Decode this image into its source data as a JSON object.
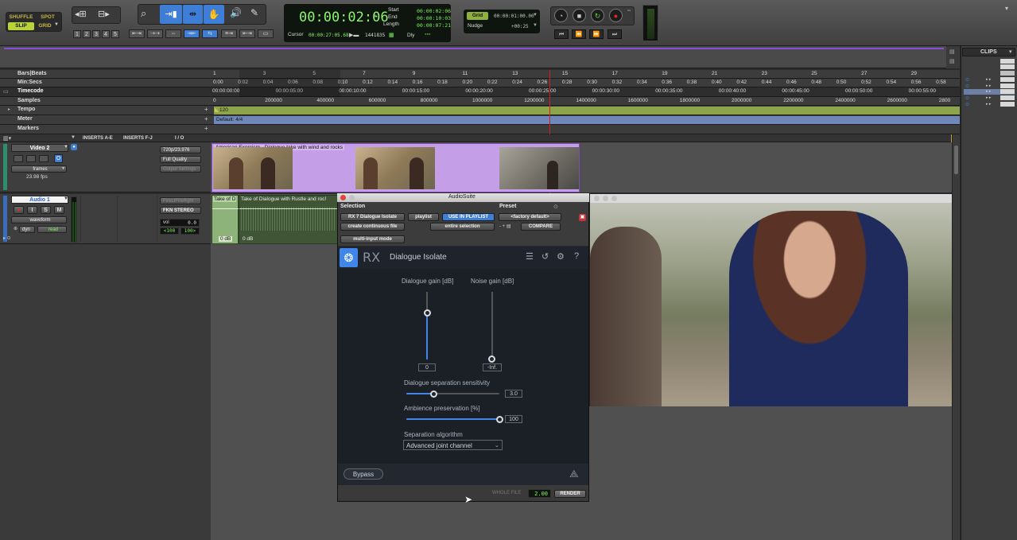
{
  "edit_modes": {
    "shuffle": "SHUFFLE",
    "spot": "SPOT",
    "slip": "SLIP",
    "grid": "GRID"
  },
  "zoom_presets": [
    "1",
    "2",
    "3",
    "4",
    "5"
  ],
  "counter": {
    "main": "00:00:02:06",
    "start_label": "Start",
    "end_label": "End",
    "length_label": "Length",
    "start": "00:00:02:06",
    "end": "00:00:10:03",
    "length": "00:00:07:21",
    "cursor_label": "Cursor",
    "cursor": "00:00:27:05.68",
    "samples": "1441835",
    "dly_label": "Dly"
  },
  "grid": {
    "label": "Grid",
    "value": "00:00:01:00.00",
    "nudge_label": "Nudge",
    "nudge_value": "+00:25"
  },
  "clips_panel": {
    "title": "CLIPS"
  },
  "rulers": {
    "bars_beats": {
      "label": "Bars|Beats",
      "ticks": [
        "1",
        "3",
        "5",
        "7",
        "9",
        "11",
        "13",
        "15",
        "17",
        "19",
        "21",
        "23",
        "25",
        "27",
        "29"
      ]
    },
    "min_secs": {
      "label": "Min:Secs",
      "ticks": [
        "0:00",
        "0:02",
        "0:04",
        "0:06",
        "0:08",
        "0:10",
        "0:12",
        "0:14",
        "0:16",
        "0:18",
        "0:20",
        "0:22",
        "0:24",
        "0:26",
        "0:28",
        "0:30",
        "0:32",
        "0:34",
        "0:36",
        "0:38",
        "0:40",
        "0:42",
        "0:44",
        "0:46",
        "0:48",
        "0:50",
        "0:52",
        "0:54",
        "0:56",
        "0:58"
      ]
    },
    "timecode": {
      "label": "Timecode",
      "ticks": [
        "00:00:00:00",
        "00:00:05:00",
        "00:00:10:00",
        "00:00:15:00",
        "00:00:20:00",
        "00:00:25:00",
        "00:00:30:00",
        "00:00:35:00",
        "00:00:40:00",
        "00:00:45:00",
        "00:00:50:00",
        "00:00:55:00"
      ]
    },
    "samples": {
      "label": "Samples",
      "ticks": [
        "0",
        "200000",
        "400000",
        "600000",
        "800000",
        "1000000",
        "1200000",
        "1400000",
        "1600000",
        "1800000",
        "2000000",
        "2200000",
        "2400000",
        "2600000",
        "2800"
      ]
    },
    "tempo": {
      "label": "Tempo",
      "value": "120"
    },
    "meter": {
      "label": "Meter",
      "value": "Default: 4/4"
    },
    "markers": {
      "label": "Markers"
    }
  },
  "columns": {
    "inserts_ae": "INSERTS A-E",
    "inserts_fj": "INSERTS F-J",
    "io": "I / O"
  },
  "video_track": {
    "name": "Video 2",
    "format": "720p/23.976",
    "quality": "Full Quality",
    "settings": "Output Settings",
    "view": "frames",
    "fps": "23.98 fps",
    "clip_name": "American Exorcism - Dialogue take with wind and rocks"
  },
  "audio_track": {
    "name": "Audio 1",
    "input": "FireLtFireRght",
    "output": "FKN STEREO",
    "view": "waveform",
    "automation": "dyn",
    "auto_mode": "read",
    "vol_label": "vol",
    "vol_value": "0.0",
    "pan_left": "<100",
    "pan_right": "100>",
    "clip1": "Take of D",
    "clip2": "Take of Dialogue with Rustle and roc!",
    "gain1": "0 dB",
    "gain2": "0 dB",
    "btn_i": "I",
    "btn_s": "S",
    "btn_m": "M"
  },
  "audiosuite": {
    "title": "AudioSuite",
    "selection_label": "Selection",
    "preset_label": "Preset",
    "plugin": "RX 7 Dialogue Isolate",
    "playlist": "playlist",
    "use_in_playlist": "USE IN PLAYLIST",
    "factory_default": "<factory default>",
    "continuous": "create continuous file",
    "entire_selection": "entire selection",
    "compare": "COMPARE",
    "multi_input": "multi-input mode",
    "whole_file": "WHOLE FILE",
    "handle": "2.00",
    "render": "RENDER"
  },
  "plugin": {
    "brand": "RX",
    "name": "Dialogue Isolate",
    "dialogue_gain_label": "Dialogue gain [dB]",
    "noise_gain_label": "Noise gain [dB]",
    "dialogue_gain": "0",
    "noise_gain": "-Inf.",
    "sensitivity_label": "Dialogue separation sensitivity",
    "sensitivity": "3.0",
    "ambience_label": "Ambience preservation [%]",
    "ambience": "100",
    "algorithm_label": "Separation algorithm",
    "algorithm": "Advanced joint channel",
    "bypass": "Bypass"
  },
  "colors": {
    "accent": "#3f86e8",
    "lcd": "#7df05a",
    "video_clip": "#c49ee6",
    "tempo": "#8da34c",
    "meter": "#6f88b9",
    "playhead": "#d02020"
  }
}
